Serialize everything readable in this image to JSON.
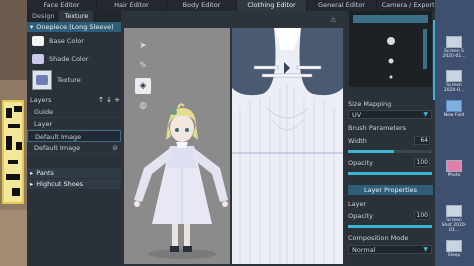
{
  "top_tabs": [
    "Face Editor",
    "Hair Editor",
    "Body Editor",
    "Clothing Editor",
    "General Editor",
    "Camera / Exporter"
  ],
  "sub_tabs": [
    "Design",
    "Texture"
  ],
  "section": {
    "title": "Onepiece (Long Sleeve)",
    "base_color_label": "Base Color",
    "shade_color_label": "Shade Color",
    "texture_label": "Texture",
    "base_color": "#f4f4f4",
    "shade_color": "#c9c9ee"
  },
  "layers": {
    "label": "Layers",
    "items": [
      "Guide",
      "Layer",
      "Default Image",
      "Default Image"
    ]
  },
  "collapsed_sections": [
    "Pants",
    "Highcut Shoes"
  ],
  "right_panel": {
    "size_mapping_label": "Size Mapping",
    "size_mapping_value": "UV",
    "brush_parameters_label": "Brush Parameters",
    "width_label": "Width",
    "width_value": "64",
    "opacity_label": "Opacity",
    "opacity_value": "100",
    "layer_properties_label": "Layer Properties",
    "layer_label": "Layer",
    "layer_opacity_label": "Opacity",
    "layer_opacity_value": "100",
    "composition_mode_label": "Composition Mode",
    "composition_mode_value": "Normal"
  },
  "desktop_icons": [
    "Screen S 2020-01...",
    "Screen 2020-0...",
    "New Fold",
    "Photo",
    "Screen Shot 2020-01...",
    "Sleep"
  ],
  "colors": {
    "accent": "#3fb3d6",
    "section_header": "#2f5f78"
  },
  "sliders": {
    "width_fraction": 0.55,
    "opacity_fraction": 1.0,
    "layer_opacity_fraction": 1.0
  }
}
